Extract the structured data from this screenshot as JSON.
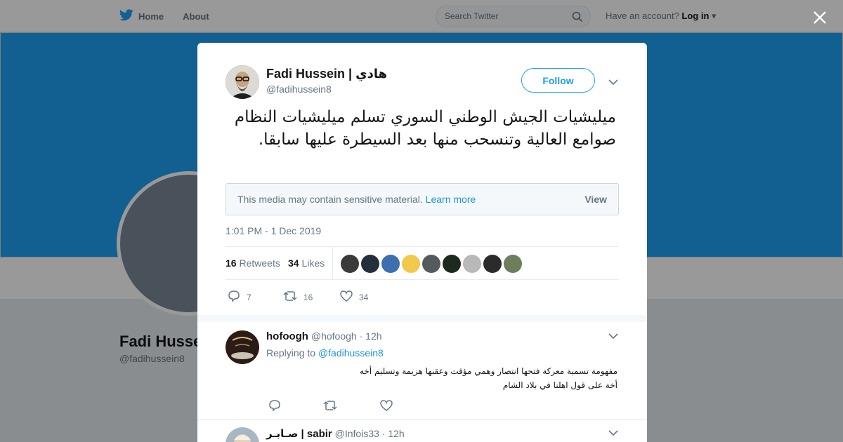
{
  "nav": {
    "home_label": "Home",
    "about_label": "About",
    "search_placeholder": "Search Twitter",
    "have_account": "Have an account?",
    "login_label": "Log in"
  },
  "profile": {
    "name": "Fadi Hussein",
    "handle": "@fadihussein8"
  },
  "tweet": {
    "author_name": "Fadi Hussein | هادي",
    "author_handle": "@fadihussein8",
    "follow_label": "Follow",
    "text": "ميليشيات الجيش الوطني السوري تسلم ميليشيات النظام صوامع العالية وتنسحب منها بعد السيطرة عليها سابقا.",
    "sensitive_text": "This media may contain sensitive material.",
    "learn_more": "Learn more",
    "view_label": "View",
    "timestamp": "1:01 PM - 1 Dec 2019",
    "retweets_count": "16",
    "retweets_label": "Retweets",
    "likes_count": "34",
    "likes_label": "Likes",
    "reply_count": "7",
    "retweet_action_count": "16",
    "like_action_count": "34",
    "liker_avatar_colors": [
      "#3a3a3a",
      "#23303c",
      "#3b6fb0",
      "#f2c94c",
      "#555a5e",
      "#1e2a1f",
      "#b9b9b9",
      "#2b2b2b",
      "#6d7e5a"
    ]
  },
  "replies": [
    {
      "name": "hofoogh",
      "handle": "@hofoogh",
      "time": "12h",
      "replying_prefix": "Replying to",
      "replying_to": "@fadihussein8",
      "text_line1": "مفهومة تسمية معركة فتحها انتصار وهمي مؤقت وعقبها هزيمة وتسليم أخه",
      "text_line2": "أخة على قول اهلنا في بلاد الشام"
    },
    {
      "name": "صـابـر | sabir",
      "handle": "@Infois33",
      "time": "12h"
    }
  ],
  "colors": {
    "accent": "#1da1f2",
    "link": "#1b95e0",
    "muted": "#657786"
  }
}
